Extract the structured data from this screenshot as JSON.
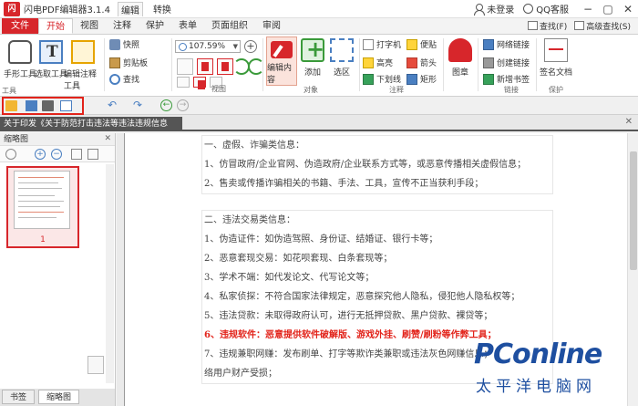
{
  "app": {
    "logo_text": "闪",
    "title": "闪电PDF编辑器3.1.4",
    "top_tabs": [
      "编辑",
      "转换"
    ]
  },
  "titlebar": {
    "login": "未登录",
    "qq": "QQ客服",
    "win": [
      "−",
      "▢",
      "✕"
    ]
  },
  "ribbon_tabs": {
    "file": "文件",
    "tabs": [
      "开始",
      "视图",
      "注释",
      "保护",
      "表单",
      "页面组织",
      "审阅"
    ],
    "active": "开始",
    "find": "查找(F)",
    "advanced_find": "高级查找(S)"
  },
  "ribbon": {
    "tools_group": {
      "hand": "手形工具",
      "select_text": "选取工具",
      "edit_note": "编辑注释工具",
      "label": "工具"
    },
    "snapshot": "快照",
    "clipboard": "剪贴板",
    "find": "查找",
    "view_group": {
      "zoom": "107.59%",
      "label": "视图"
    },
    "objects_group": {
      "edit_content": "编辑内容",
      "add": "添加",
      "select_area": "选区",
      "label": "对象"
    },
    "comment_group": {
      "typewriter": "打字机",
      "highlight": "高亮",
      "underline": "下划线",
      "note": "便贴",
      "arrow": "箭头",
      "rect": "矩形",
      "label": "注释"
    },
    "stamp": "图章",
    "link_group": {
      "web_link": "网络链接",
      "create_link": "创建链接",
      "new_bookmark": "新增书签",
      "label": "链接"
    },
    "protect_group": {
      "sign": "签名文档",
      "label": "保护"
    }
  },
  "quickbar": {
    "undo": "↶",
    "redo": "↷",
    "back": "←",
    "forward": "→"
  },
  "doc_tab": {
    "name": "关于印发《关于防范打击违法等违法违规信息",
    "close": "✕"
  },
  "sidebar": {
    "title": "缩略图",
    "close": "✕",
    "page_num": "1",
    "tabs": [
      "书签",
      "缩略图"
    ],
    "active_tab": "缩略图"
  },
  "document": {
    "block1": [
      "一、虚假、诈骗类信息：",
      "1、仿冒政府/企业官网、伪造政府/企业联系方式等，或恶意传播相关虚假信息；",
      "2、售卖或传播诈骗相关的书籍、手法、工具，宣传不正当获利手段；"
    ],
    "block2": [
      "二、违法交易类信息：",
      "1、伪造证件：如伪造驾照、身份证、结婚证、银行卡等；",
      "2、恶意套现交易：如花呗套现、白条套现等；",
      "3、学术不端：如代发论文、代写论文等；",
      "4、私家侦探：不符合国家法律规定，恶意探究他人隐私，侵犯他人隐私权等；",
      "5、违法贷款：未取得政府认可，进行无抵押贷款、黑户贷款、裸贷等；",
      "6、违规软件：恶意提供软件破解版、游戏外挂、刷赞/刷粉等作弊工具；",
      "7、违规兼职网赚：发布刷单、打字等欺诈类兼职或违法灰色网赚信息；",
      "络用户财产受损；"
    ]
  },
  "watermark": {
    "brand": "PConline",
    "sub": "太平洋电脑网"
  }
}
